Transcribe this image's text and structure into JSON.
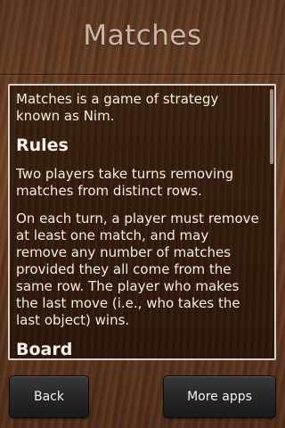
{
  "header": {
    "title": "Matches"
  },
  "content": {
    "intro": "Matches is a game of strategy known as Nim.",
    "rules_heading": "Rules",
    "rules_p1": "Two players take turns removing matches from distinct rows.",
    "rules_p2": "On each turn, a player must remove at least one match, and may remove any number of matches provided they all come from the same row. The player who makes the last move (i.e., who takes the last object) wins.",
    "board_heading": "Board"
  },
  "footer": {
    "back_label": "Back",
    "more_apps_label": "More apps"
  }
}
